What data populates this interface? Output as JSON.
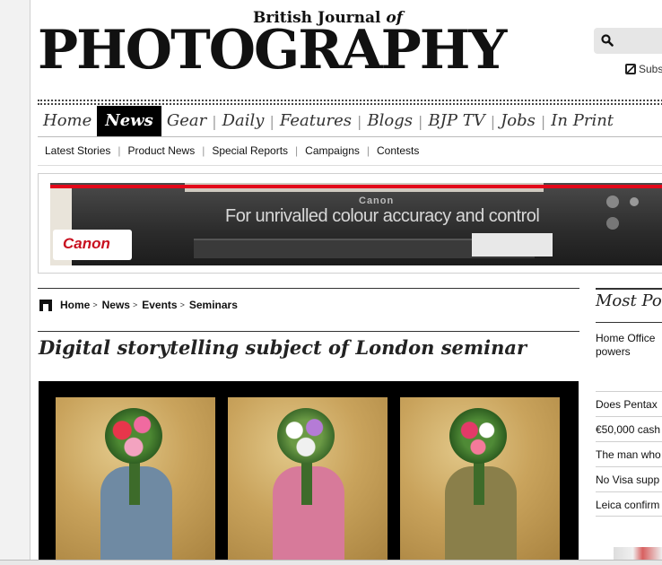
{
  "masthead": {
    "small_prefix": "British Journal ",
    "small_italic": "of",
    "title": "PHOTOGRAPHY"
  },
  "header": {
    "subscribe_label": "Subs"
  },
  "nav": {
    "items": [
      {
        "label": "Home"
      },
      {
        "label": "News"
      },
      {
        "label": "Gear"
      },
      {
        "label": "Daily"
      },
      {
        "label": "Features"
      },
      {
        "label": "Blogs"
      },
      {
        "label": "BJP TV"
      },
      {
        "label": "Jobs"
      },
      {
        "label": "In Print"
      }
    ],
    "active": "News"
  },
  "subnav": {
    "items": [
      {
        "label": "Latest Stories"
      },
      {
        "label": "Product News"
      },
      {
        "label": "Special Reports"
      },
      {
        "label": "Campaigns"
      },
      {
        "label": "Contests"
      }
    ]
  },
  "ad": {
    "brand": "Canon",
    "tagline": "For unrivalled colour accuracy and control",
    "logo": "Canon",
    "accent": "#e3081a"
  },
  "breadcrumb": {
    "items": [
      "Home",
      "News",
      "Events",
      "Seminars"
    ],
    "separator": ">"
  },
  "article": {
    "title": "Digital storytelling subject of London seminar"
  },
  "sidebar": {
    "title": "Most Po",
    "feature": "Home Office powers",
    "items": [
      "Does Pentax",
      "€50,000 cash",
      "The man who",
      "No Visa supp",
      "Leica confirm"
    ]
  }
}
